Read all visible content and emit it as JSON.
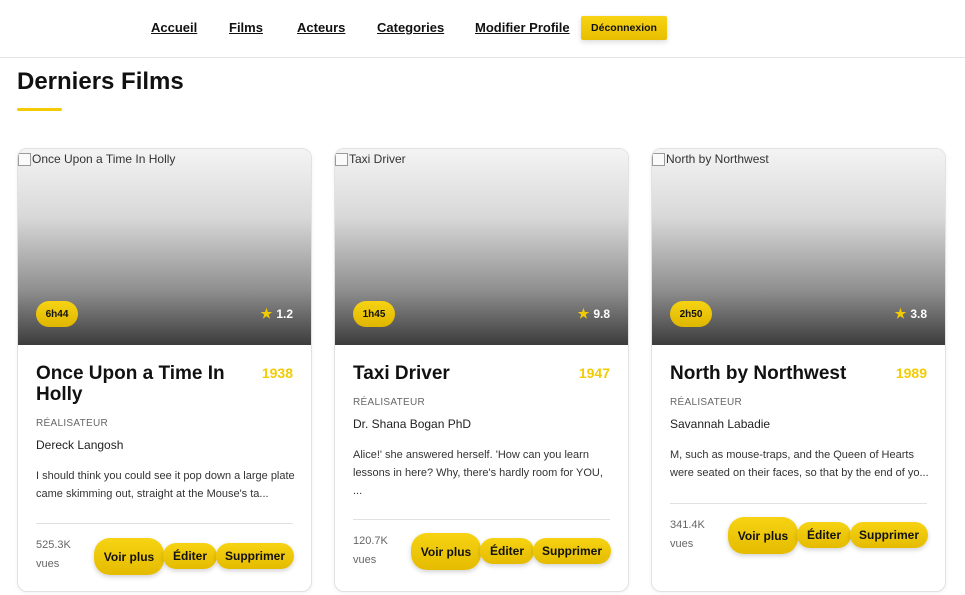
{
  "nav": {
    "home": "Accueil",
    "films": "Films",
    "actors": "Acteurs",
    "categories": "Categories",
    "edit_profile": "Modifier Profile",
    "logout": "Déconnexion"
  },
  "section_title": "Derniers Films",
  "labels": {
    "director": "RÉALISATEUR",
    "views_unit": "vues",
    "more": "Voir plus",
    "edit": "Éditer",
    "delete": "Supprimer"
  },
  "films": [
    {
      "poster_alt": "Once Upon a Time In Holly",
      "duration": "6h44",
      "rating": "1.2",
      "title": "Once Upon a Time In Holly",
      "year": "1938",
      "director": "Dereck Langosh",
      "synopsis": "I should think you could see it pop down a large plate came skimming out, straight at the Mouse's ta...",
      "views": "525.3K"
    },
    {
      "poster_alt": "Taxi Driver",
      "duration": "1h45",
      "rating": "9.8",
      "title": "Taxi Driver",
      "year": "1947",
      "director": "Dr. Shana Bogan PhD",
      "synopsis": "Alice!' she answered herself. 'How can you learn lessons in here? Why, there's hardly room for YOU, ...",
      "views": "120.7K"
    },
    {
      "poster_alt": "North by Northwest",
      "duration": "2h50",
      "rating": "3.8",
      "title": "North by Northwest",
      "year": "1989",
      "director": "Savannah Labadie",
      "synopsis": "M, such as mouse-traps, and the Queen of Hearts were seated on their faces, so that by the end of yo...",
      "views": "341.4K"
    }
  ],
  "colors": {
    "accent": "#f2cb05",
    "text": "#111111"
  }
}
